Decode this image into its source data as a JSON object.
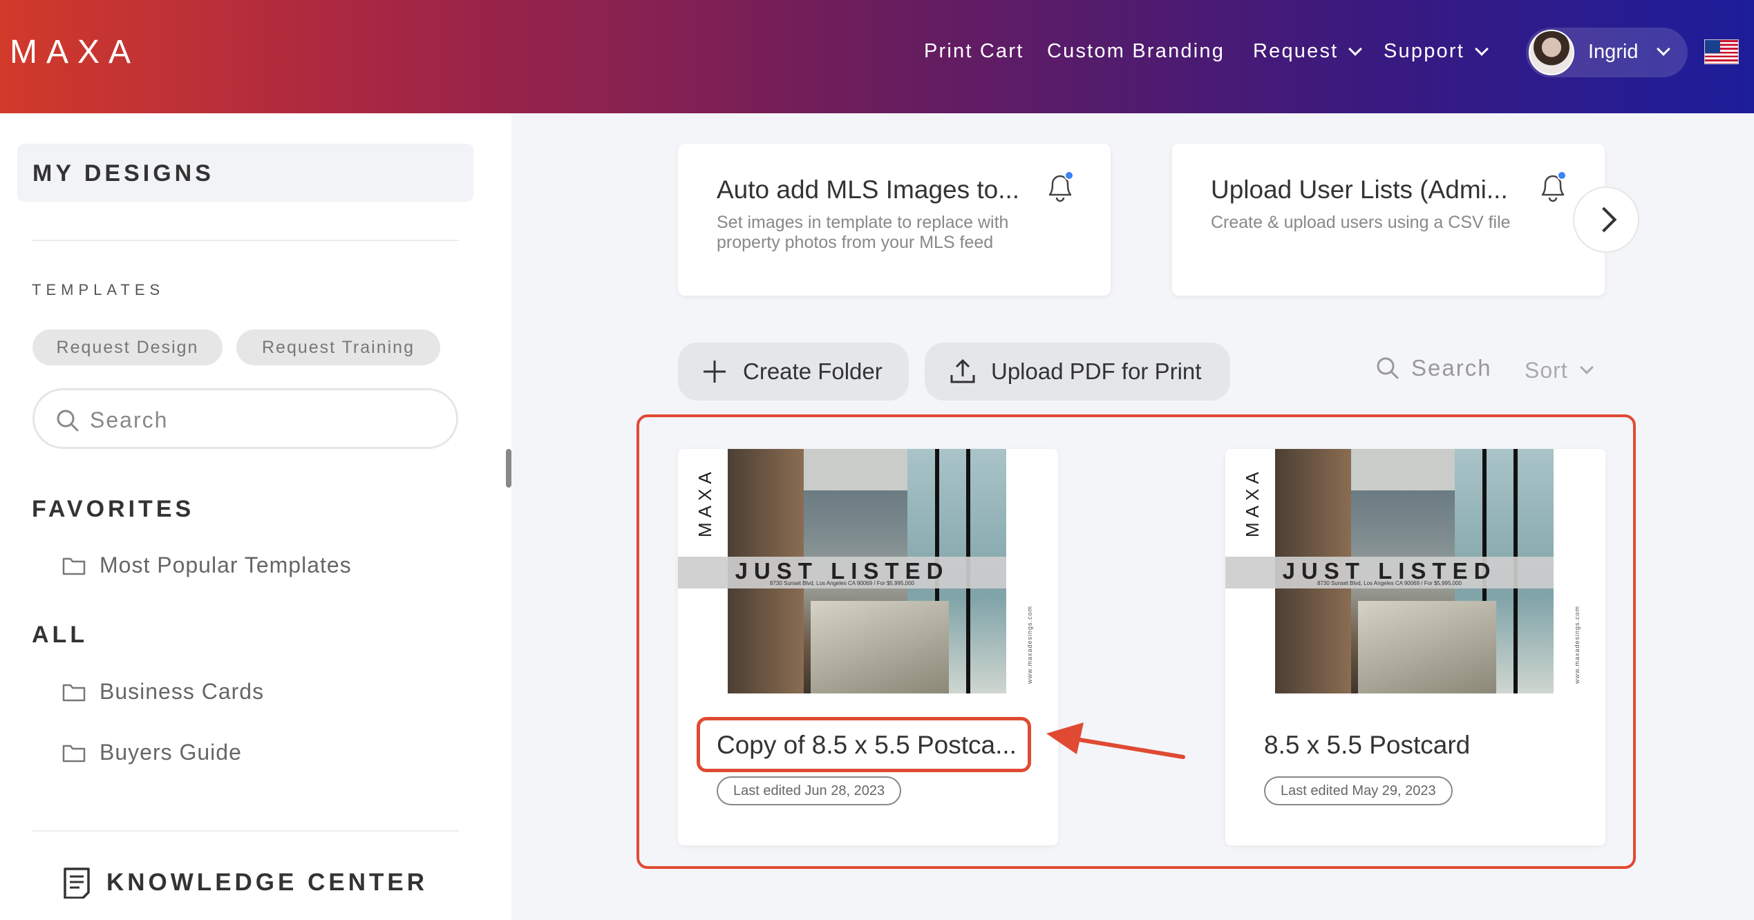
{
  "header": {
    "logo": "MAXA",
    "nav": [
      {
        "label": "Print Cart"
      },
      {
        "label": "Custom Branding"
      },
      {
        "label": "Request"
      },
      {
        "label": "Support"
      }
    ],
    "user_name": "Ingrid"
  },
  "sidebar": {
    "my_designs": "MY DESIGNS",
    "templates_heading": "TEMPLATES",
    "chips": [
      "Request Design",
      "Request Training"
    ],
    "search_placeholder": "Search",
    "favorites_heading": "FAVORITES",
    "favorites": [
      "Most Popular Templates"
    ],
    "all_heading": "ALL",
    "all_folders": [
      "Business Cards",
      "Buyers Guide"
    ],
    "knowledge_center": "KNOWLEDGE CENTER"
  },
  "notifications": [
    {
      "title": "Auto add MLS Images to...",
      "desc_line1": "Set images in template to replace with",
      "desc_line2": "property photos from your MLS feed"
    },
    {
      "title": "Upload User Lists (Admi...",
      "desc_line1": "Create & upload users using a CSV file",
      "desc_line2": ""
    }
  ],
  "toolbar": {
    "create_folder": "Create Folder",
    "upload_pdf": "Upload PDF for Print",
    "search": "Search",
    "sort": "Sort"
  },
  "designs": [
    {
      "title": "Copy of 8.5 x 5.5 Postca...",
      "last_edited": "Last edited Jun 28, 2023",
      "thumb_brand": "MAXA",
      "thumb_headline": "JUST LISTED",
      "thumb_address": "8730 Sunset Blvd, Los Angeles CA 90069 / For $5,995,000",
      "thumb_website": "www.maxadesings.com"
    },
    {
      "title": "8.5 x 5.5 Postcard",
      "last_edited": "Last edited May 29, 2023",
      "thumb_brand": "MAXA",
      "thumb_headline": "JUST LISTED",
      "thumb_address": "8730 Sunset Blvd, Los Angeles CA 90069 / For $5,995,000",
      "thumb_website": "www.maxadesings.com"
    }
  ],
  "colors": {
    "annotation_red": "#e04a33",
    "header_gradient_start": "#d23a2a",
    "header_gradient_end": "#1d1d9a",
    "notification_dot": "#3b82f6"
  }
}
